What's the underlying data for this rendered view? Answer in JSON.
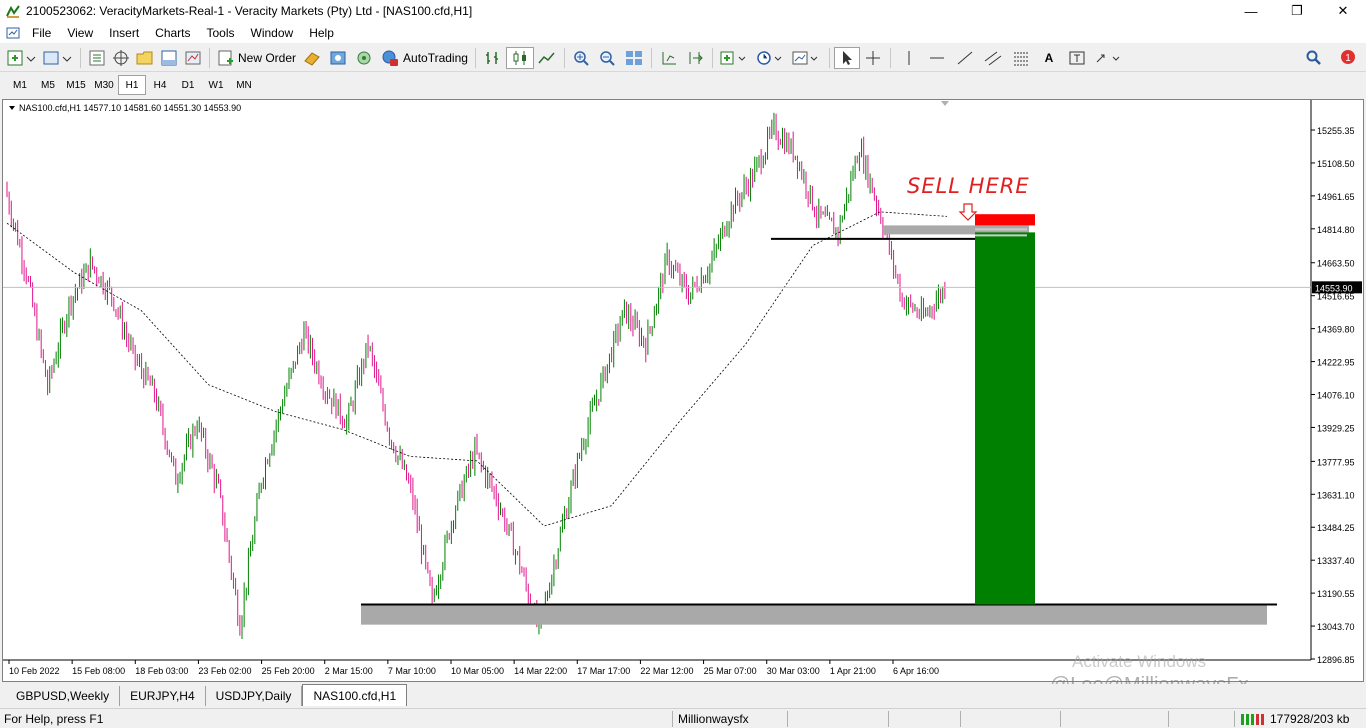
{
  "window": {
    "title": "2100523062: VeracityMarkets-Real-1 - Veracity Markets (Pty) Ltd - [NAS100.cfd,H1]"
  },
  "menu": [
    "File",
    "View",
    "Insert",
    "Charts",
    "Tools",
    "Window",
    "Help"
  ],
  "toolbar": {
    "new_order_label": "New Order",
    "autotrading_label": "AutoTrading",
    "notification_count": "1"
  },
  "timeframes": [
    "M1",
    "M5",
    "M15",
    "M30",
    "H1",
    "H4",
    "D1",
    "W1",
    "MN"
  ],
  "active_timeframe": "H1",
  "chart": {
    "header": "NAS100.cfd,H1  14577.10 14581.60 14551.30 14553.90",
    "annotation": "SELL HERE",
    "current_price": "14553.90",
    "price_labels": [
      "15255.35",
      "15108.50",
      "14961.65",
      "14814.80",
      "14663.50",
      "14516.65",
      "14369.80",
      "14222.95",
      "14076.10",
      "13929.25",
      "13777.95",
      "13631.10",
      "13484.25",
      "13337.40",
      "13190.55",
      "13043.70",
      "12896.85"
    ],
    "time_labels": [
      "10 Feb 2022",
      "15 Feb 08:00",
      "18 Feb 03:00",
      "23 Feb 02:00",
      "25 Feb 20:00",
      "2 Mar 15:00",
      "7 Mar 10:00",
      "10 Mar 05:00",
      "14 Mar 22:00",
      "17 Mar 17:00",
      "22 Mar 12:00",
      "25 Mar 07:00",
      "30 Mar 03:00",
      "1 Apr 21:00",
      "6 Apr 16:00"
    ],
    "colors": {
      "bull": "#008000",
      "bear": "#e0148c",
      "tp_zone": "#008000",
      "sl_zone": "#ff0000",
      "zone_grey": "#a9a9a9",
      "annotation": "#e02020"
    }
  },
  "chart_data": {
    "type": "candlestick",
    "symbol": "NAS100.cfd",
    "timeframe": "H1",
    "ohlc_last": {
      "open": 14577.1,
      "high": 14581.6,
      "low": 14551.3,
      "close": 14553.9
    },
    "ylim": [
      12896.85,
      15255.35
    ],
    "price_path": [
      [
        "10 Feb 2022",
        15000
      ],
      [
        "11 Feb",
        14620
      ],
      [
        "11 Feb",
        14110
      ],
      [
        "14 Feb",
        14480
      ],
      [
        "15 Feb 08:00",
        14660
      ],
      [
        "16 Feb",
        14520
      ],
      [
        "17 Feb",
        14250
      ],
      [
        "18 Feb 03:00",
        14080
      ],
      [
        "18 Feb",
        13700
      ],
      [
        "22 Feb",
        13950
      ],
      [
        "23 Feb 02:00",
        13650
      ],
      [
        "24 Feb",
        13050
      ],
      [
        "24 Feb",
        13700
      ],
      [
        "25 Feb",
        14050
      ],
      [
        "25 Feb 20:00",
        14350
      ],
      [
        "28 Feb",
        14100
      ],
      [
        "1 Mar",
        13950
      ],
      [
        "2 Mar 15:00",
        14300
      ],
      [
        "3 Mar",
        13900
      ],
      [
        "4 Mar",
        13650
      ],
      [
        "7 Mar 10:00",
        13150
      ],
      [
        "8 Mar",
        13550
      ],
      [
        "9 Mar",
        13820
      ],
      [
        "10 Mar 05:00",
        13620
      ],
      [
        "11 Mar",
        13350
      ],
      [
        "14 Mar",
        13020
      ],
      [
        "14 Mar 22:00",
        13450
      ],
      [
        "15 Mar",
        13850
      ],
      [
        "16 Mar",
        14150
      ],
      [
        "17 Mar 17:00",
        14450
      ],
      [
        "18 Mar",
        14300
      ],
      [
        "21 Mar",
        14680
      ],
      [
        "22 Mar 12:00",
        14520
      ],
      [
        "23 Mar",
        14650
      ],
      [
        "24 Mar",
        14900
      ],
      [
        "25 Mar 07:00",
        15050
      ],
      [
        "28 Mar",
        15260
      ],
      [
        "29 Mar",
        15150
      ],
      [
        "30 Mar 03:00",
        14880
      ],
      [
        "31 Mar",
        14800
      ],
      [
        "1 Apr 21:00",
        15180
      ],
      [
        "4 Apr",
        14870
      ],
      [
        "5 Apr",
        14500
      ],
      [
        "6 Apr",
        14420
      ],
      [
        "6 Apr 16:00",
        14553.9
      ]
    ],
    "moving_average": [
      [
        "10 Feb 2022",
        14840
      ],
      [
        "15 Feb 08:00",
        14620
      ],
      [
        "18 Feb 03:00",
        14450
      ],
      [
        "23 Feb 02:00",
        14120
      ],
      [
        "25 Feb 20:00",
        14000
      ],
      [
        "2 Mar 15:00",
        13920
      ],
      [
        "7 Mar 10:00",
        13800
      ],
      [
        "10 Mar 05:00",
        13780
      ],
      [
        "14 Mar 22:00",
        13490
      ],
      [
        "17 Mar 17:00",
        13580
      ],
      [
        "22 Mar 12:00",
        13950
      ],
      [
        "25 Mar 07:00",
        14300
      ],
      [
        "30 Mar 03:00",
        14740
      ],
      [
        "1 Apr 21:00",
        14890
      ],
      [
        "6 Apr 16:00",
        14870
      ]
    ],
    "levels": {
      "resistance_line": 14770,
      "entry_zone": [
        14790,
        14830
      ],
      "stop_loss_zone": [
        14830,
        14880
      ],
      "take_profit": 13140,
      "support_zone": [
        13050,
        13140
      ]
    }
  },
  "tabs": [
    "GBPUSD,Weekly",
    "EURJPY,H4",
    "USDJPY,Daily",
    "NAS100.cfd,H1"
  ],
  "active_tab": "NAS100.cfd,H1",
  "status": {
    "help": "For Help, press F1",
    "profile": "Millionwaysfx",
    "traffic": "177928/203 kb"
  },
  "watermark": {
    "activate": "Activate Windows",
    "credit": "@Lee@MillionwaysFx"
  }
}
